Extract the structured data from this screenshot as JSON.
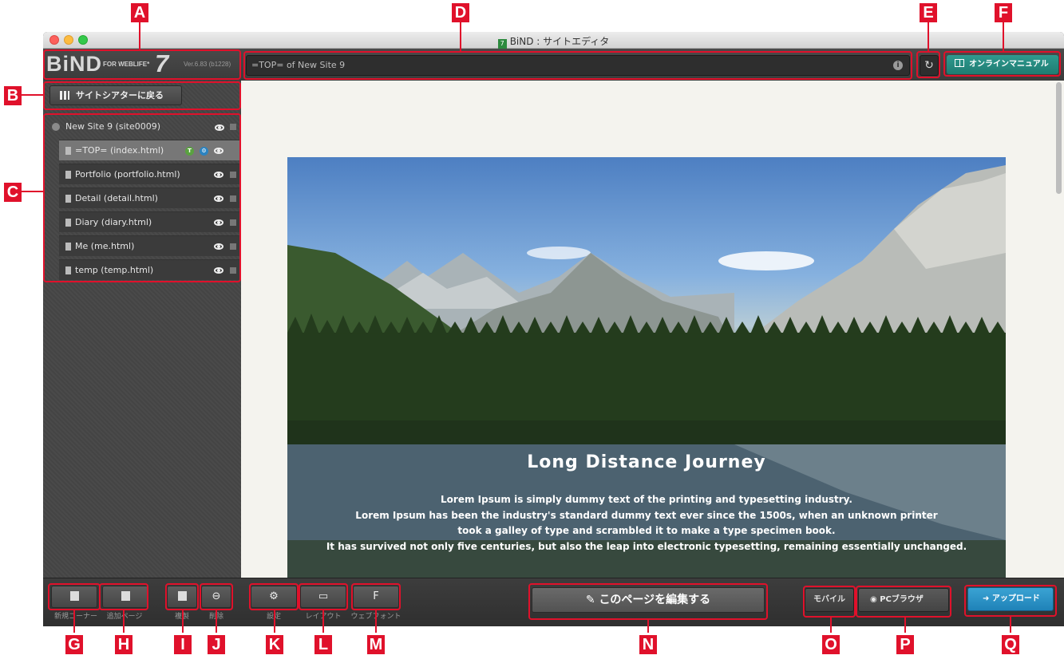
{
  "window": {
    "title": "BiND : サイトエディタ",
    "app_icon_glyph": "7"
  },
  "toolbar": {
    "logo": "BiND",
    "logo_sub": "FOR WEBLIFE*",
    "logo_num": "7",
    "version": "Ver.6.83 (b1228)",
    "url": "=TOP= of New Site 9",
    "info_glyph": "i",
    "reload_glyph": "↻",
    "manual_label": "オンラインマニュアル"
  },
  "sidebar": {
    "back_label": "サイトシアターに戻る",
    "site": "New Site 9 (site0009)",
    "pages": [
      {
        "label": "=TOP= (index.html)"
      },
      {
        "label": "Portfolio (portfolio.html)"
      },
      {
        "label": "Detail (detail.html)"
      },
      {
        "label": "Diary (diary.html)"
      },
      {
        "label": "Me (me.html)"
      },
      {
        "label": "temp (temp.html)"
      }
    ]
  },
  "content": {
    "hero_title": "Long Distance Journey",
    "hero_lines": [
      "Lorem Ipsum is simply dummy text of the printing and typesetting industry.",
      "Lorem Ipsum has been the industry's standard dummy text ever since the 1500s, when an unknown printer",
      "took a galley of type and scrambled it to make a type specimen book.",
      "It has survived not only five centuries, but also the leap into electronic typesetting, remaining essentially unchanged."
    ]
  },
  "bottombar": {
    "new_corner_label": "新規コーナー",
    "add_page_label": "追加ページ",
    "duplicate_label": "複製",
    "delete_label": "削除",
    "settings_label": "設定",
    "layout_label": "レイアウト",
    "webfont_label": "ウェブフォント",
    "webfont_glyph": "F",
    "edit_label": "このページを編集する",
    "mobile_label": "モバイル",
    "pc_browser_label": "PCブラウザ",
    "upload_label": "アップロード"
  },
  "callouts": {
    "A": "A",
    "B": "B",
    "C": "C",
    "D": "D",
    "E": "E",
    "F": "F",
    "G": "G",
    "H": "H",
    "I": "I",
    "J": "J",
    "K": "K",
    "L": "L",
    "M": "M",
    "N": "N",
    "O": "O",
    "P": "P",
    "Q": "Q"
  },
  "colors": {
    "callout_red": "#e0112b",
    "manual_teal": "#2f9a8f",
    "upload_blue": "#2a93c6"
  }
}
